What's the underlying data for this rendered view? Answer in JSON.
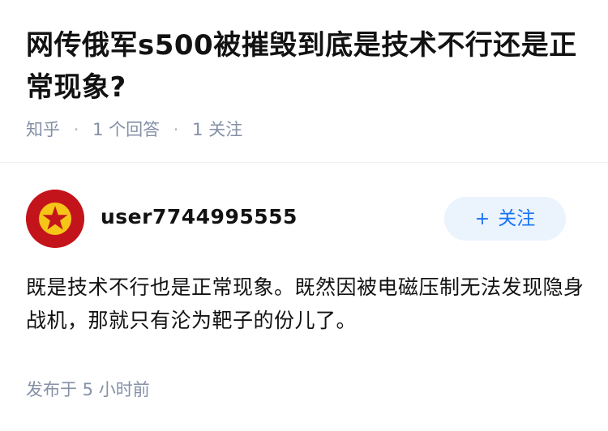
{
  "question": {
    "title": "网传俄军s500被摧毁到底是技术不行还是正常现象?",
    "source": "知乎",
    "answer_count": "1 个回答",
    "follow_count": "1 关注",
    "separator": "·"
  },
  "answer": {
    "author": {
      "name": "user7744995555",
      "avatar_icon": "red-star-emblem-icon"
    },
    "follow_button": {
      "icon": "+",
      "label": "关注"
    },
    "content": "既是技术不行也是正常现象。既然因被电磁压制无法发现隐身战机，那就只有沦为靶子的份儿了。",
    "published": "发布于 5 小时前"
  },
  "colors": {
    "title": "#121212",
    "meta": "#8590a6",
    "accent": "#1772f6",
    "button_bg": "#ebf4fd",
    "avatar_red": "#c4141b",
    "avatar_gold": "#f5c518"
  }
}
